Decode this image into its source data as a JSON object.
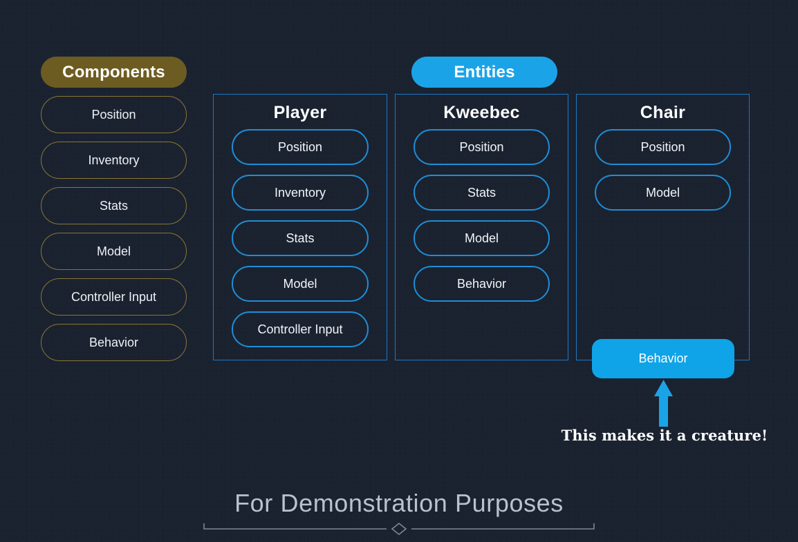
{
  "background_color": "#1a2230",
  "components": {
    "header_label": "Components",
    "header_color": "#6d5c21",
    "chip_border_color": "#8a7634",
    "items": [
      {
        "label": "Position"
      },
      {
        "label": "Inventory"
      },
      {
        "label": "Stats"
      },
      {
        "label": "Model"
      },
      {
        "label": "Controller Input"
      },
      {
        "label": "Behavior"
      }
    ]
  },
  "entities": {
    "header_label": "Entities",
    "header_color": "#1ba3e8",
    "frame_border_color": "#1c78c4",
    "chip_border_color": "#1f8ed6",
    "columns": [
      {
        "title": "Player",
        "components": [
          {
            "label": "Position"
          },
          {
            "label": "Inventory"
          },
          {
            "label": "Stats"
          },
          {
            "label": "Model"
          },
          {
            "label": "Controller Input"
          }
        ]
      },
      {
        "title": "Kweebec",
        "components": [
          {
            "label": "Position"
          },
          {
            "label": "Stats"
          },
          {
            "label": "Model"
          },
          {
            "label": "Behavior"
          }
        ]
      },
      {
        "title": "Chair",
        "components": [
          {
            "label": "Position"
          },
          {
            "label": "Model"
          }
        ]
      }
    ]
  },
  "highlight": {
    "box_label": "Behavior",
    "box_color": "#0fa3e8",
    "arrow_color": "#1ba3e8",
    "annotation": "This makes it a creature!"
  },
  "footer": {
    "title": "For Demonstration Purposes",
    "divider_color": "#7d8796"
  }
}
